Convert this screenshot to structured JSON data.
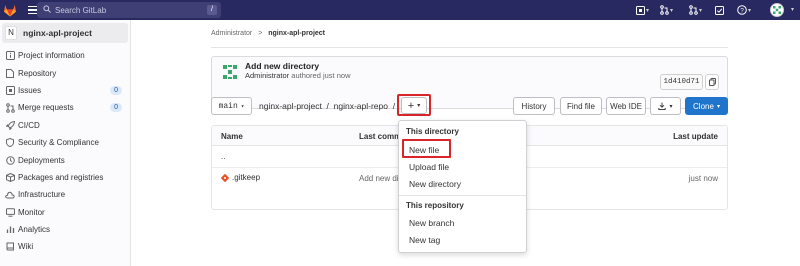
{
  "topbar": {
    "search_placeholder": "Search GitLab",
    "search_shortcut": "/",
    "icons": [
      "gitlab-logo",
      "menu-icon",
      "search-icon",
      "issues-icon",
      "merge-request-icon",
      "todo-icon",
      "help-icon",
      "user-avatar"
    ]
  },
  "sidebar": {
    "project_initial": "N",
    "project_name": "nginx-apl-project",
    "items": [
      {
        "label": "Project information",
        "icon": "info-icon"
      },
      {
        "label": "Repository",
        "icon": "doc-icon"
      },
      {
        "label": "Issues",
        "icon": "issues-icon",
        "badge": "0"
      },
      {
        "label": "Merge requests",
        "icon": "merge-request-icon",
        "badge": "0"
      },
      {
        "label": "CI/CD",
        "icon": "rocket-icon"
      },
      {
        "label": "Security & Compliance",
        "icon": "shield-icon"
      },
      {
        "label": "Deployments",
        "icon": "deployments-icon"
      },
      {
        "label": "Packages and registries",
        "icon": "package-icon"
      },
      {
        "label": "Infrastructure",
        "icon": "cloud-icon"
      },
      {
        "label": "Monitor",
        "icon": "monitor-icon"
      },
      {
        "label": "Analytics",
        "icon": "chart-icon"
      },
      {
        "label": "Wiki",
        "icon": "book-icon"
      }
    ]
  },
  "breadcrumb": {
    "root": "Administrator",
    "sep": ">",
    "current": "nginx-apl-project"
  },
  "commit": {
    "title": "Add new directory",
    "author": "Administrator",
    "action": "authored just now",
    "sha": "1d410d71"
  },
  "toolbar": {
    "branch": "main",
    "path": "nginx-apl-project  /  nginx-apl-repo  /",
    "plus": "+",
    "history": "History",
    "find_file": "Find file",
    "web_ide": "Web IDE",
    "clone": "Clone"
  },
  "table": {
    "headers": {
      "name": "Name",
      "last_commit": "Last commit",
      "last_update": "Last update"
    },
    "rows": [
      {
        "name": "..",
        "commit": "",
        "update": ""
      },
      {
        "name": ".gitkeep",
        "commit": "Add new directory",
        "update": "just now"
      }
    ]
  },
  "dropdown": {
    "section1": "This directory",
    "new_file": "New file",
    "upload_file": "Upload file",
    "new_directory": "New directory",
    "section2": "This repository",
    "new_branch": "New branch",
    "new_tag": "New tag"
  },
  "colors": {
    "topbar": "#292961",
    "accent": "#1f75cb",
    "highlight": "#d9252a",
    "badge_bg": "#dbe8f8"
  }
}
